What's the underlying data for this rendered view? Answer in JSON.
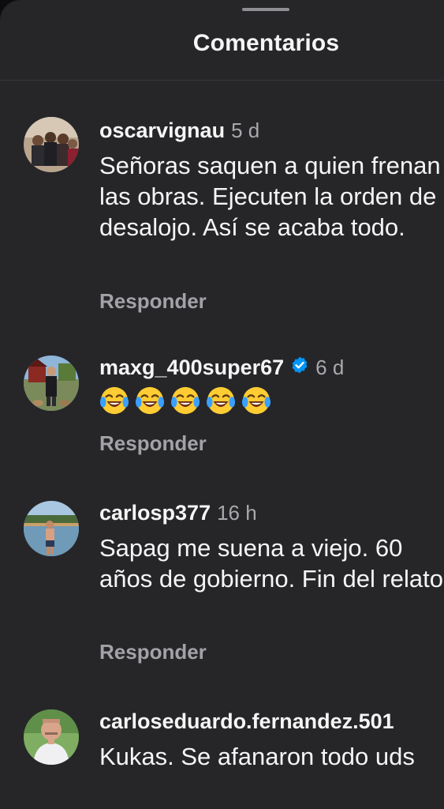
{
  "sheet": {
    "title": "Comentarios"
  },
  "comments": [
    {
      "username": "oscarvignau",
      "time": "5 d",
      "text": "Señoras saquen a quien frenan las obras.  Ejecuten la orden de desalojo. Así se acaba todo.",
      "reply_label": "Responder",
      "verified": false
    },
    {
      "username": "maxg_400super67",
      "time": "6 d",
      "emoji_count": 5,
      "emoji_name": "face-with-tears-of-joy-icon",
      "reply_label": "Responder",
      "verified": true
    },
    {
      "username": "carlosp377",
      "time": "16 h",
      "text": "Sapag me suena a viejo. 60 años de gobierno. Fin del relato",
      "reply_label": "Responder",
      "verified": false
    },
    {
      "username": "carloseduardo.fernandez.501",
      "time": "",
      "text": "Kukas. Se afanaron todo uds",
      "verified": false
    }
  ],
  "colors": {
    "sheet_background": "#262629",
    "verified_badge": "#0095f6",
    "secondary_text": "#a8a8ad"
  }
}
